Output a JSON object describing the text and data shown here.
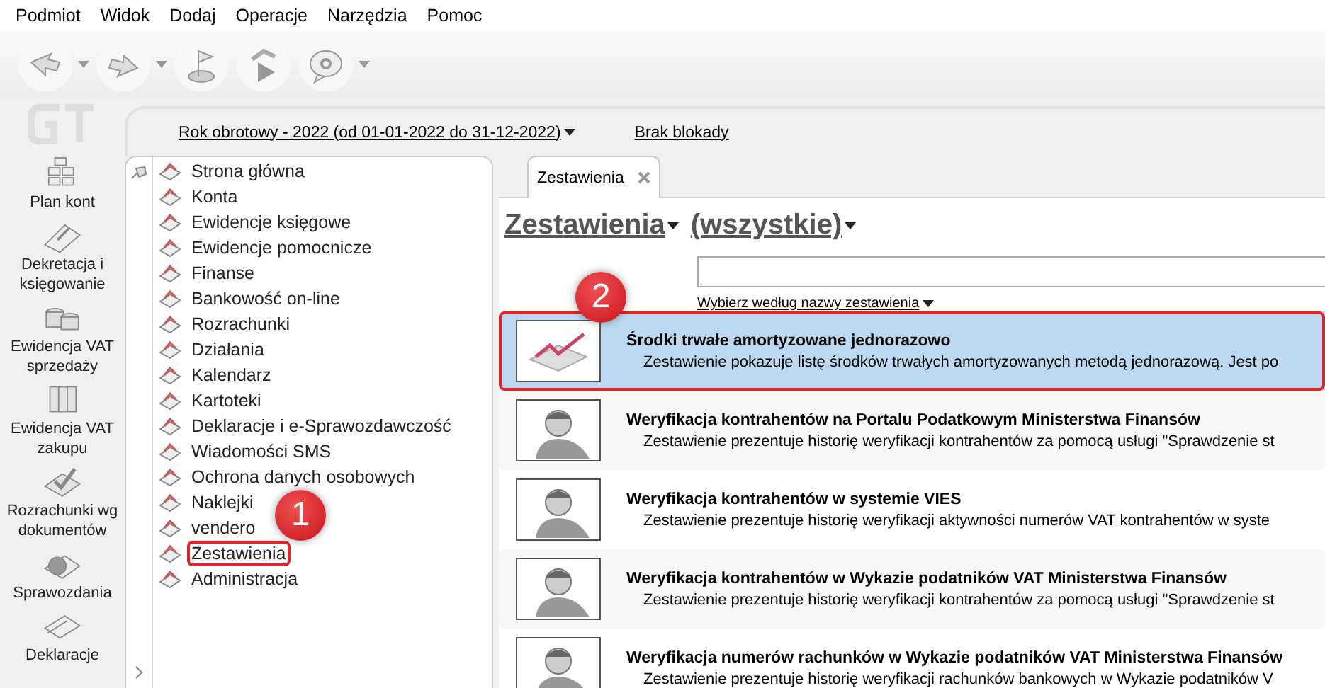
{
  "menu": [
    "Podmiot",
    "Widok",
    "Dodaj",
    "Operacje",
    "Narzędzia",
    "Pomoc"
  ],
  "toolbar": [
    {
      "kind": "back",
      "dropdown": true
    },
    {
      "kind": "forward",
      "dropdown": true
    },
    {
      "kind": "flag",
      "dropdown": false
    },
    {
      "kind": "run",
      "dropdown": false
    },
    {
      "kind": "help",
      "dropdown": true
    }
  ],
  "sidebar": [
    {
      "label": "Plan kont",
      "kind": "blocks"
    },
    {
      "label": "Dekretacja i księgowanie",
      "kind": "clip"
    },
    {
      "label": "Ewidencja VAT sprzedaży",
      "kind": "coins"
    },
    {
      "label": "Ewidencja VAT zakupu",
      "kind": "binders"
    },
    {
      "label": "Rozrachunki wg dokumentów",
      "kind": "check"
    },
    {
      "label": "Sprawozdania",
      "kind": "pie"
    },
    {
      "label": "Deklaracje",
      "kind": "papers"
    }
  ],
  "period": {
    "label": "Rok obrotowy - 2022  (od 01-01-2022 do 31-12-2022)",
    "lock": "Brak blokady"
  },
  "nav": [
    {
      "label": "Strona główna",
      "outlined": false
    },
    {
      "label": "Konta",
      "outlined": false
    },
    {
      "label": "Ewidencje księgowe",
      "outlined": false
    },
    {
      "label": "Ewidencje pomocnicze",
      "outlined": false
    },
    {
      "label": "Finanse",
      "outlined": false
    },
    {
      "label": "Bankowość on-line",
      "outlined": false
    },
    {
      "label": "Rozrachunki",
      "outlined": false
    },
    {
      "label": "Działania",
      "outlined": false
    },
    {
      "label": "Kalendarz",
      "outlined": false
    },
    {
      "label": "Kartoteki",
      "outlined": false
    },
    {
      "label": "Deklaracje i e-Sprawozdawczość",
      "outlined": false
    },
    {
      "label": "Wiadomości SMS",
      "outlined": false
    },
    {
      "label": "Ochrona danych osobowych",
      "outlined": false
    },
    {
      "label": "Naklejki",
      "outlined": false
    },
    {
      "label": "vendero",
      "outlined": false
    },
    {
      "label": "Zestawienia",
      "outlined": true
    },
    {
      "label": "Administracja",
      "outlined": false
    }
  ],
  "tab": {
    "label": "Zestawienia",
    "selected": true
  },
  "heading": {
    "category": "Zestawienia",
    "filter": "(wszystkie)"
  },
  "search": {
    "mode": "Wybierz według nazwy zestawienia"
  },
  "reports": [
    {
      "kind": "chart",
      "title": "Środki trwałe amortyzowane jednorazowo",
      "description": "Zestawienie pokazuje listę środków trwałych amortyzowanych metodą jednorazową. Jest po",
      "selected": true
    },
    {
      "kind": "person",
      "title": "Weryfikacja kontrahentów na Portalu Podatkowym Ministerstwa Finansów",
      "description": "Zestawienie prezentuje historię weryfikacji kontrahentów za pomocą usługi \"Sprawdzenie st",
      "selected": false
    },
    {
      "kind": "person",
      "title": "Weryfikacja kontrahentów w systemie VIES",
      "description": "Zestawienie prezentuje historię weryfikacji aktywności numerów VAT kontrahentów w syste",
      "selected": false
    },
    {
      "kind": "person",
      "title": "Weryfikacja kontrahentów w Wykazie podatników VAT Ministerstwa Finansów",
      "description": "Zestawienie prezentuje historię weryfikacji kontrahentów za pomocą usługi \"Sprawdzenie st",
      "selected": false
    },
    {
      "kind": "person",
      "title": "Weryfikacja numerów rachunków w Wykazie podatników VAT Ministerstwa Finansów",
      "description": "Zestawienie prezentuje historię weryfikacji rachunków bankowych w Wykazie podatników V",
      "selected": false
    }
  ],
  "nav_callout": "1",
  "reports_callout": "2"
}
